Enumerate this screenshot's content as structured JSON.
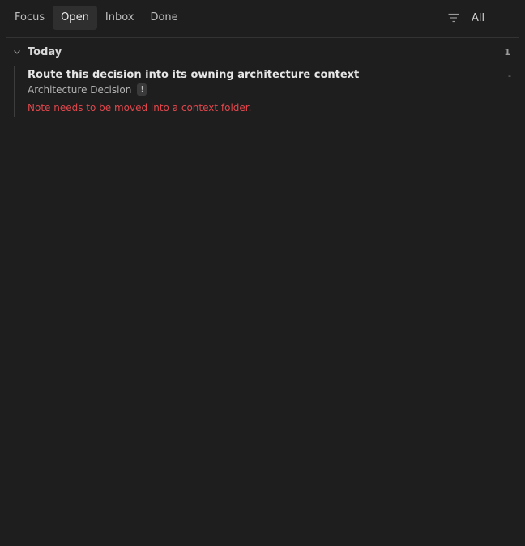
{
  "tabs": [
    {
      "label": "Focus",
      "active": false
    },
    {
      "label": "Open",
      "active": true
    },
    {
      "label": "Inbox",
      "active": false
    },
    {
      "label": "Done",
      "active": false
    }
  ],
  "filter": {
    "icon": "filter-icon",
    "value": "All"
  },
  "group": {
    "title": "Today",
    "count": "1",
    "icon": "chevron-down-icon"
  },
  "item": {
    "title": "Route this decision into its owning architecture context",
    "type": "Architecture Decision",
    "badge": "!",
    "date": "-",
    "note": "Note needs to be moved into a context folder."
  },
  "colors": {
    "background": "#1e1e1e",
    "active_tab": "#2f2f2f",
    "warning_text": "#e0474c"
  }
}
